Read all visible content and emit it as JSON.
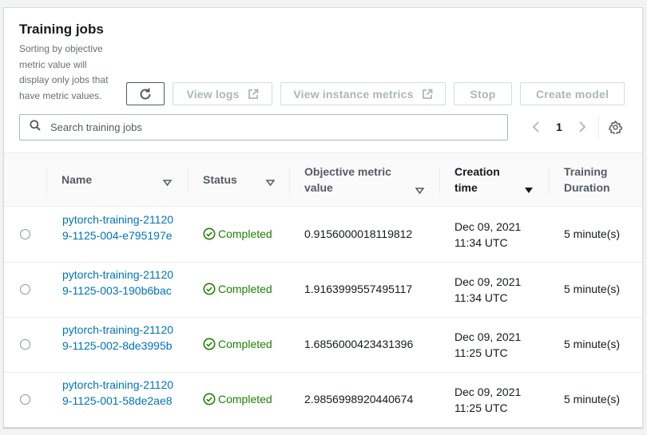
{
  "header": {
    "title": "Training jobs",
    "description": "Sorting by objective metric value will display only jobs that have metric values."
  },
  "toolbar": {
    "view_logs": "View logs",
    "view_instance_metrics": "View instance metrics",
    "stop": "Stop",
    "create_model": "Create model"
  },
  "search": {
    "placeholder": "Search training jobs",
    "value": ""
  },
  "pagination": {
    "current_page": "1"
  },
  "table": {
    "columns": {
      "name": "Name",
      "status": "Status",
      "metric": "Objective metric value",
      "creation_time": "Creation time",
      "duration": "Training Duration"
    },
    "rows": [
      {
        "name": "pytorch-training-211209-1125-004-e795197e",
        "status": "Completed",
        "metric": "0.9156000018119812",
        "creation_date": "Dec 09, 2021",
        "creation_time": "11:34 UTC",
        "duration": "5 minute(s)"
      },
      {
        "name": "pytorch-training-211209-1125-003-190b6bac",
        "status": "Completed",
        "metric": "1.9163999557495117",
        "creation_date": "Dec 09, 2021",
        "creation_time": "11:34 UTC",
        "duration": "5 minute(s)"
      },
      {
        "name": "pytorch-training-211209-1125-002-8de3995b",
        "status": "Completed",
        "metric": "1.6856000423431396",
        "creation_date": "Dec 09, 2021",
        "creation_time": "11:25 UTC",
        "duration": "5 minute(s)"
      },
      {
        "name": "pytorch-training-211209-1125-001-58de2ae8",
        "status": "Completed",
        "metric": "2.9856998920440674",
        "creation_date": "Dec 09, 2021",
        "creation_time": "11:25 UTC",
        "duration": "5 minute(s)"
      }
    ]
  },
  "colors": {
    "link": "#0073bb",
    "success": "#1d8102",
    "disabled": "#aab7b8",
    "border": "#d5dbdb"
  }
}
